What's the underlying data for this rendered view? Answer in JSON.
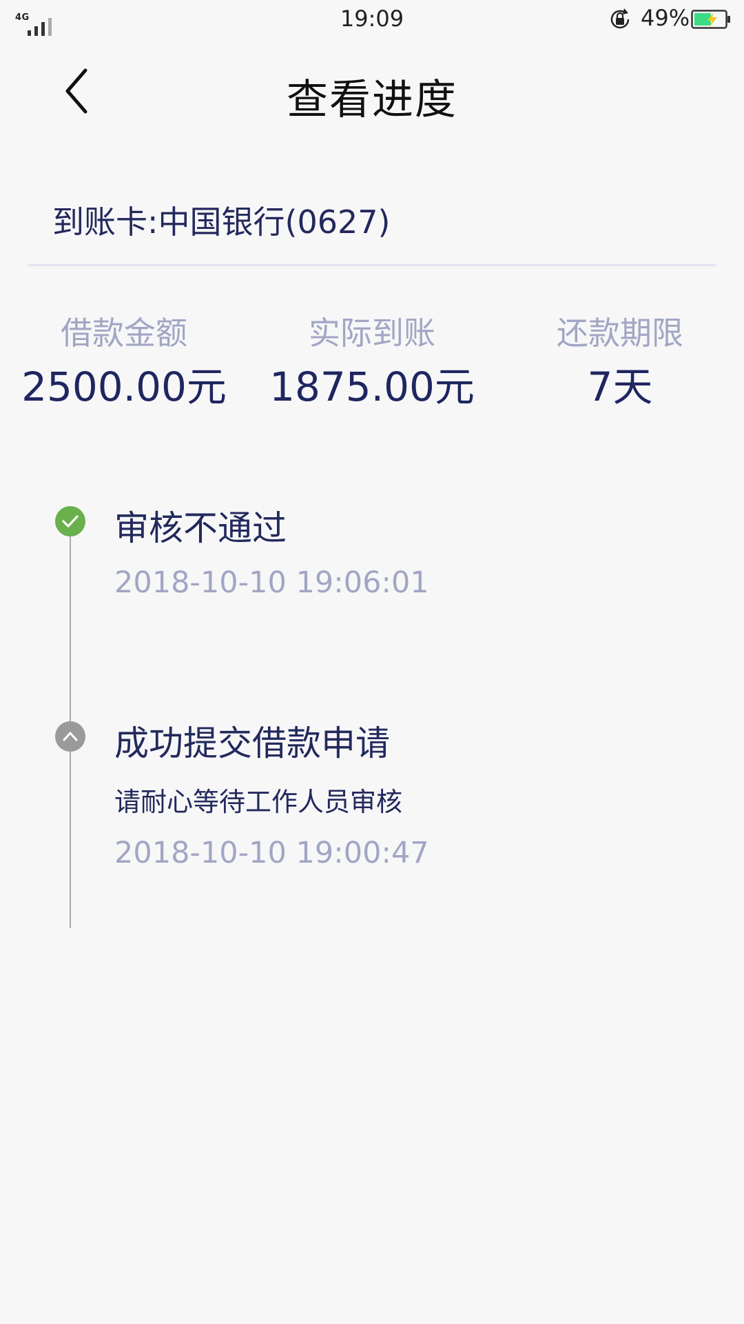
{
  "status_bar": {
    "network": "4G",
    "time": "19:09",
    "battery_percent": "49%",
    "icons": [
      "signal-icon",
      "rotation-lock-icon",
      "battery-charging-icon"
    ]
  },
  "header": {
    "title": "查看进度",
    "back_icon": "chevron-left-icon"
  },
  "card": {
    "text": "到账卡:中国银行(0627)"
  },
  "summary": [
    {
      "label": "借款金额",
      "value": "2500.00元"
    },
    {
      "label": "实际到账",
      "value": "1875.00元"
    },
    {
      "label": "还款期限",
      "value": "7天"
    }
  ],
  "timeline": [
    {
      "title": "审核不通过",
      "time": "2018-10-10 19:06:01",
      "note": "",
      "icon": "check-circle-icon",
      "icon_color": "#6ab04c"
    },
    {
      "title": "成功提交借款申请",
      "note": "请耐心等待工作人员审核",
      "time": "2018-10-10 19:00:47",
      "icon": "chevron-up-circle-icon",
      "icon_color": "#9a9a9a"
    }
  ],
  "colors": {
    "background": "#f7f7f8",
    "primary_text": "#23295c",
    "muted_text": "#a2a6c4",
    "divider": "#e3e4f4",
    "battery_green": "#3ddc84"
  }
}
